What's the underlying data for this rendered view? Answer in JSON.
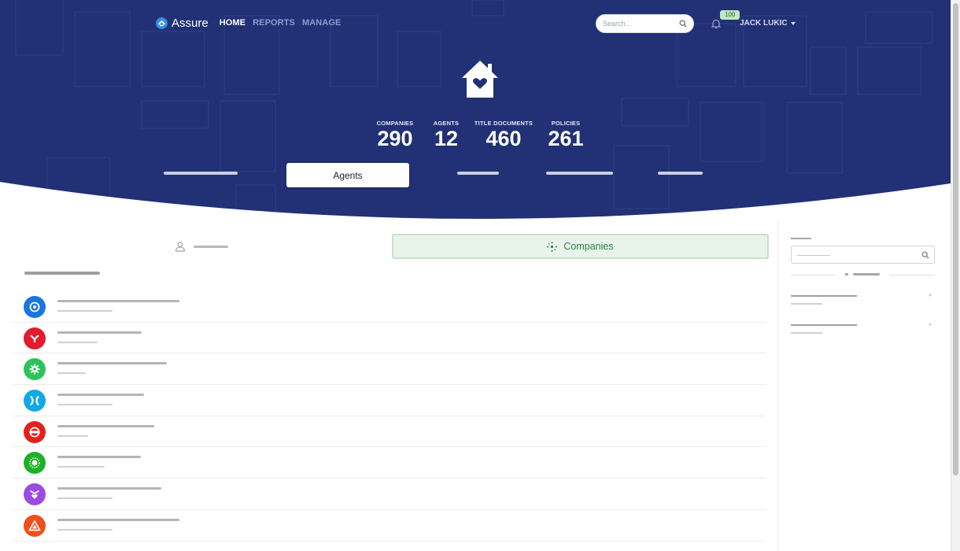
{
  "app": {
    "name": "Assure"
  },
  "nav": {
    "items": [
      {
        "label": "HOME",
        "active": true
      },
      {
        "label": "REPORTS"
      },
      {
        "label": "MANAGE"
      }
    ]
  },
  "search": {
    "placeholder": "Search..."
  },
  "notifications": {
    "count": "100"
  },
  "user": {
    "name": "JACK LUKIC"
  },
  "stats": [
    {
      "label": "COMPANIES",
      "value": "290"
    },
    {
      "label": "AGENTS",
      "value": "12"
    },
    {
      "label": "TITLE DOCUMENTS",
      "value": "460"
    },
    {
      "label": "POLICIES",
      "value": "261"
    }
  ],
  "tabs": {
    "active_label": "Agents"
  },
  "segments": {
    "companies_label": "Companies"
  },
  "colors": {
    "hero": "#223075",
    "accent_green": "#2e7d45"
  },
  "list": {
    "rows": [
      {
        "icon": "target-icon",
        "color": "#1c74e3"
      },
      {
        "icon": "fork-icon",
        "color": "#e21b2d"
      },
      {
        "icon": "gear-icon",
        "color": "#2ec35a"
      },
      {
        "icon": "cross-arrows-icon",
        "color": "#12a9e4"
      },
      {
        "icon": "ring-icon",
        "color": "#e3211a"
      },
      {
        "icon": "sun-icon",
        "color": "#1eb127"
      },
      {
        "icon": "heart-badge-icon",
        "color": "#9b4ae2"
      },
      {
        "icon": "triangle-icon",
        "color": "#f04e1a"
      }
    ]
  }
}
